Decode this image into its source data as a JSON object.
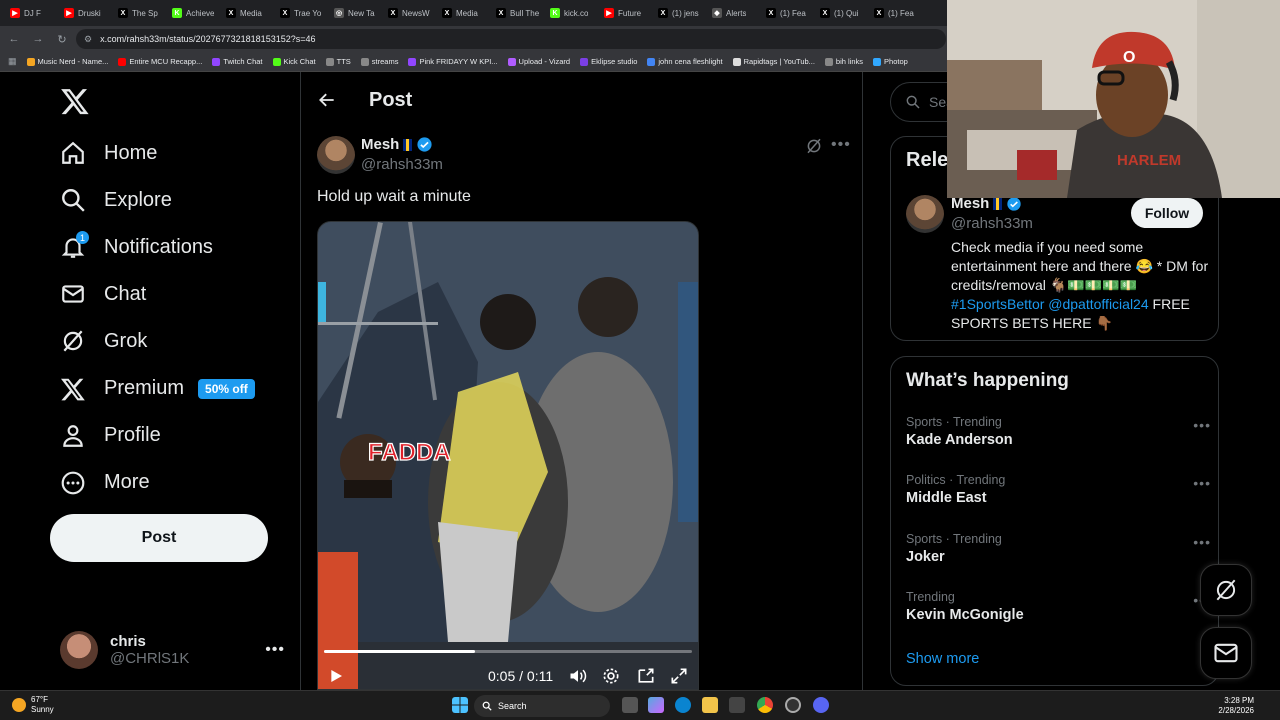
{
  "browser": {
    "tabs": [
      {
        "label": "DJ F",
        "color": "#ff0000",
        "glyph": "▶"
      },
      {
        "label": "Druski",
        "color": "#ff0000",
        "glyph": "▶"
      },
      {
        "label": "The Sp",
        "color": "#000000",
        "glyph": "X"
      },
      {
        "label": "Achieve",
        "color": "#53fc18",
        "glyph": "K"
      },
      {
        "label": "Media",
        "color": "#000000",
        "glyph": "X"
      },
      {
        "label": "Trae Yo",
        "color": "#000000",
        "glyph": "X"
      },
      {
        "label": "New Ta",
        "color": "#555555",
        "glyph": "◎"
      },
      {
        "label": "NewsW",
        "color": "#000000",
        "glyph": "X"
      },
      {
        "label": "Media",
        "color": "#000000",
        "glyph": "X"
      },
      {
        "label": "Bull The",
        "color": "#000000",
        "glyph": "X"
      },
      {
        "label": "kick.co",
        "color": "#53fc18",
        "glyph": "K"
      },
      {
        "label": "Future",
        "color": "#ff0000",
        "glyph": "▶"
      },
      {
        "label": "(1) jens",
        "color": "#000000",
        "glyph": "X"
      },
      {
        "label": "Alerts",
        "color": "#555555",
        "glyph": "◆"
      },
      {
        "label": "(1) Fea",
        "color": "#000000",
        "glyph": "X"
      },
      {
        "label": "(1) Qui",
        "color": "#000000",
        "glyph": "X"
      },
      {
        "label": "(1) Fea",
        "color": "#000000",
        "glyph": "X"
      }
    ],
    "url": "x.com/rahsh33m/status/2027677321818153152?s=46",
    "bookmarks": [
      {
        "label": "Music Nerd - Name...",
        "color": "#f5a623"
      },
      {
        "label": "Entire MCU Recapp...",
        "color": "#ff0000"
      },
      {
        "label": "Twitch Chat",
        "color": "#9146ff"
      },
      {
        "label": "Kick Chat",
        "color": "#53fc18"
      },
      {
        "label": "TTS",
        "color": "#888888"
      },
      {
        "label": "streams",
        "color": "#888888"
      },
      {
        "label": "Pink FRIDAYY W KPI...",
        "color": "#9146ff"
      },
      {
        "label": "Upload - Vizard",
        "color": "#b05cff"
      },
      {
        "label": "Eklipse studio",
        "color": "#7b3fe4"
      },
      {
        "label": "john cena fleshlight",
        "color": "#4285f4"
      },
      {
        "label": "Rapidtags | YouTub...",
        "color": "#dddddd"
      },
      {
        "label": "bih links",
        "color": "#888888"
      },
      {
        "label": "Photop",
        "color": "#31a8ff"
      }
    ]
  },
  "nav": {
    "items": [
      {
        "label": "Home",
        "icon": "home-icon"
      },
      {
        "label": "Explore",
        "icon": "search-icon"
      },
      {
        "label": "Notifications",
        "icon": "bell-icon",
        "badge": "1"
      },
      {
        "label": "Chat",
        "icon": "mail-icon"
      },
      {
        "label": "Grok",
        "icon": "grok-icon"
      },
      {
        "label": "Premium",
        "icon": "x-icon",
        "promo": "50% off"
      },
      {
        "label": "Profile",
        "icon": "person-icon"
      },
      {
        "label": "More",
        "icon": "more-circle-icon"
      }
    ],
    "post_button": "Post",
    "account": {
      "name": "chris",
      "handle": "@CHRlS1K"
    }
  },
  "post": {
    "header": "Post",
    "author_name": "Mesh",
    "author_handle": "@rahsh33m",
    "text": "Hold up wait a minute",
    "video": {
      "overlay_text": "FADDA",
      "current_time": "0:05",
      "duration": "0:11",
      "time_display": "0:05 / 0:11",
      "progress_fraction": 0.41
    }
  },
  "sidebar": {
    "search_placeholder": "Search",
    "relevant": {
      "title": "Relevant people",
      "name": "Mesh",
      "handle": "@rahsh33m",
      "follow_label": "Follow",
      "bio_1": "Check media if you need some entertainment here and there 😂 * DM for credits/removal 🐐💵💵💵💵 ",
      "bio_link": "#1SportsBettor @dpattofficial24",
      "bio_2": " FREE SPORTS BETS HERE 👇🏾"
    },
    "happening": {
      "title": "What’s happening",
      "trends": [
        {
          "context": "Sports · Trending",
          "topic": "Kade Anderson"
        },
        {
          "context": "Politics · Trending",
          "topic": "Middle East"
        },
        {
          "context": "Sports · Trending",
          "topic": "Joker"
        },
        {
          "context": "Trending",
          "topic": "Kevin McGonigle"
        }
      ],
      "show_more": "Show more"
    }
  },
  "taskbar": {
    "weather_temp": "67°F",
    "weather_desc": "Sunny",
    "search_label": "Search",
    "time": "3:28 PM",
    "date": "2/28/2026"
  },
  "colors": {
    "accent": "#1d9bf0",
    "background": "#000000",
    "border": "#2f3336",
    "muted": "#71767b"
  }
}
